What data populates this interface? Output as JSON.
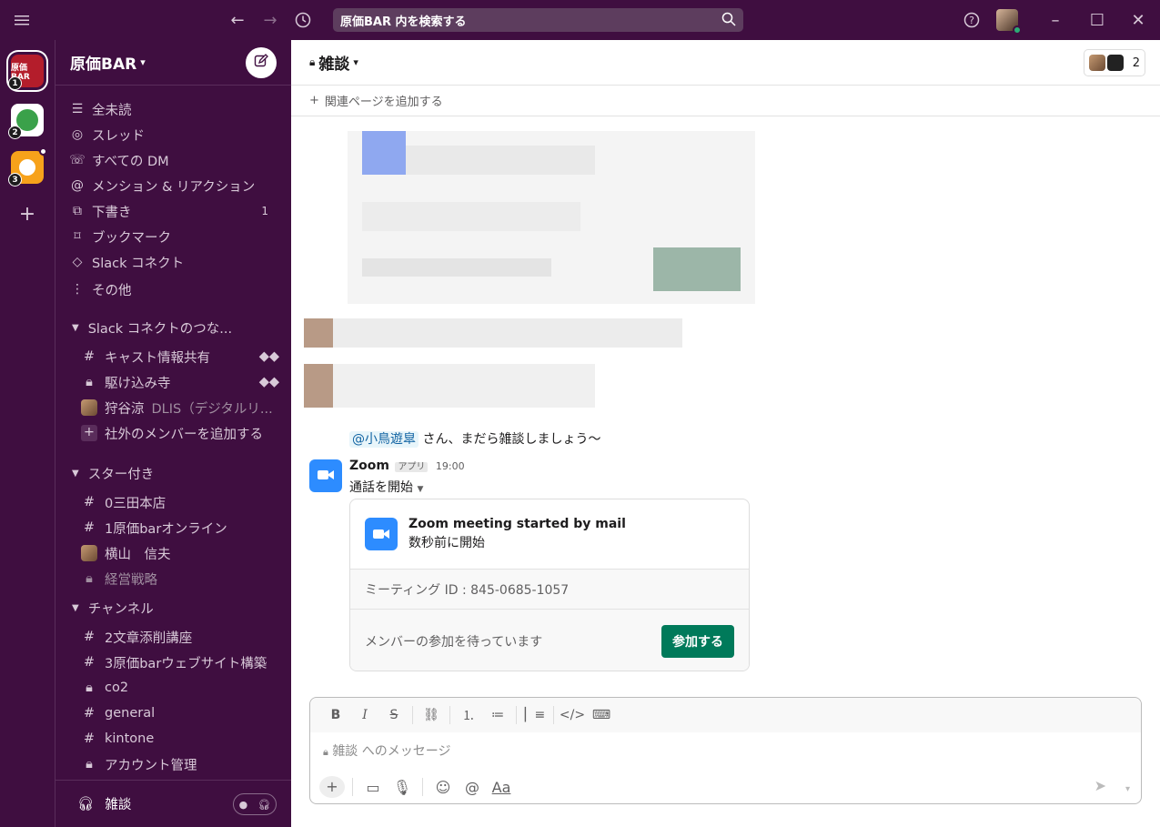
{
  "titlebar": {
    "search_label": "原価BAR 内を検索する"
  },
  "workspaces": [
    {
      "label": "原価BAR",
      "badge": "1",
      "color": "#b41d2b"
    },
    {
      "label": "",
      "badge": "2",
      "color": "#3aa14a"
    },
    {
      "label": "",
      "badge": "3",
      "color": "#f7a21b"
    }
  ],
  "sidebar": {
    "workspace_name": "原価BAR",
    "nav": [
      {
        "label": "全未読",
        "icon": "unreads-icon"
      },
      {
        "label": "スレッド",
        "icon": "threads-icon"
      },
      {
        "label": "すべての DM",
        "icon": "dm-icon"
      },
      {
        "label": "メンション & リアクション",
        "icon": "mention-icon"
      },
      {
        "label": "下書き",
        "icon": "drafts-icon",
        "count": "1"
      },
      {
        "label": "ブックマーク",
        "icon": "bookmark-icon"
      },
      {
        "label": "Slack コネクト",
        "icon": "connect-icon"
      },
      {
        "label": "その他",
        "icon": "more-icon"
      }
    ],
    "sections": [
      {
        "title": "Slack コネクトのつな...",
        "items": [
          {
            "label": "キャスト情報共有",
            "type": "hash"
          },
          {
            "label": "駆け込み寺",
            "type": "lock"
          },
          {
            "label": "狩谷涼",
            "secondary": "DLIS（デジタルリ...",
            "type": "person"
          },
          {
            "label": "社外のメンバーを追加する",
            "type": "add"
          }
        ]
      },
      {
        "title": "スター付き",
        "items": [
          {
            "label": "0三田本店",
            "type": "hash"
          },
          {
            "label": "1原価barオンライン",
            "type": "hash"
          },
          {
            "label": "横山　信夫",
            "type": "person"
          },
          {
            "label": "経営戦略",
            "type": "lock",
            "muted": true
          }
        ]
      },
      {
        "title": "チャンネル",
        "items": [
          {
            "label": "2文章添削講座",
            "type": "hash"
          },
          {
            "label": "3原価barウェブサイト構築",
            "type": "hash"
          },
          {
            "label": "co2",
            "type": "lock"
          },
          {
            "label": "general",
            "type": "hash"
          },
          {
            "label": "kintone",
            "type": "hash"
          },
          {
            "label": "アカウント管理",
            "type": "lock"
          }
        ]
      }
    ],
    "footer_label": "雑談"
  },
  "channel": {
    "name": "雑談",
    "member_count": "2",
    "add_bookmark": "関連ページを追加する"
  },
  "messages": {
    "mention": "@小鳥遊皐",
    "mention_text": "さん、まだら雑談しましょう〜",
    "zoom": {
      "sender": "Zoom",
      "app_badge": "アプリ",
      "time": "19:00",
      "action": "通話を開始",
      "card_title": "Zoom meeting started by mail",
      "card_subtitle": "数秒前に開始",
      "meeting_id": "ミーティング ID : 845-0685-1057",
      "waiting": "メンバーの参加を待っています",
      "join": "参加する"
    }
  },
  "composer": {
    "placeholder": "雑談 へのメッセージ"
  }
}
